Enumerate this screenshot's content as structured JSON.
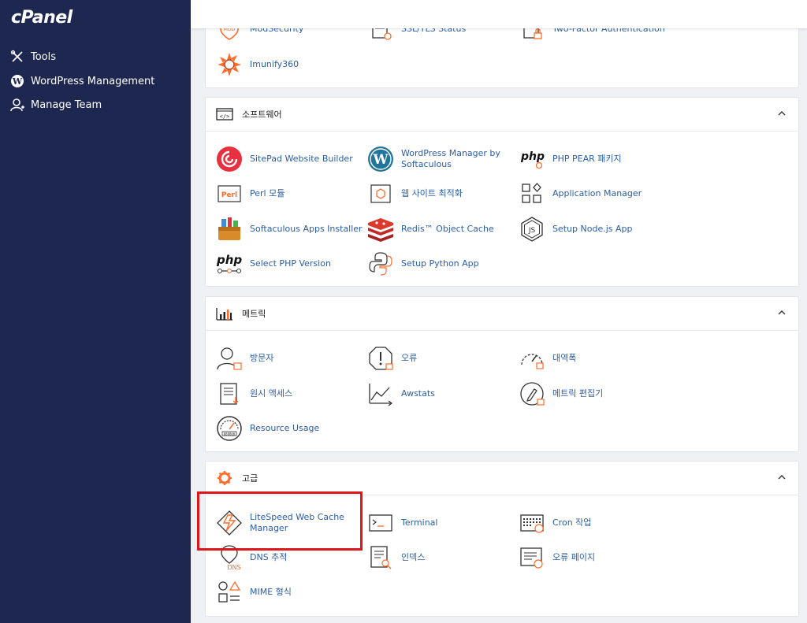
{
  "sidebar": {
    "logo": "cPanel",
    "items": [
      {
        "label": "Tools",
        "icon": "tools-icon"
      },
      {
        "label": "WordPress Management",
        "icon": "wordpress-icon"
      },
      {
        "label": "Manage Team",
        "icon": "manage-team-icon"
      }
    ]
  },
  "security": {
    "items": [
      {
        "label": "ModSecurity",
        "icon": "modsecurity-icon"
      },
      {
        "label": "SSL/TLS Status",
        "icon": "ssl-status-icon"
      },
      {
        "label": "Two-Factor Authentication",
        "icon": "two-factor-icon"
      },
      {
        "label": "Imunify360",
        "icon": "imunify360-icon"
      }
    ]
  },
  "software": {
    "title": "소프트웨어",
    "items": [
      {
        "label": "SitePad Website Builder",
        "icon": "sitepad-icon"
      },
      {
        "label": "WordPress Manager by Softaculous",
        "icon": "wordpress-manager-icon"
      },
      {
        "label": "PHP PEAR 패키지",
        "icon": "php-pear-icon"
      },
      {
        "label": "Perl 모듈",
        "icon": "perl-icon"
      },
      {
        "label": "웹 사이트 최적화",
        "icon": "site-optimize-icon"
      },
      {
        "label": "Application Manager",
        "icon": "application-manager-icon"
      },
      {
        "label": "Softaculous Apps Installer",
        "icon": "softaculous-icon"
      },
      {
        "label": "Redis™ Object Cache",
        "icon": "redis-icon"
      },
      {
        "label": "Setup Node.js App",
        "icon": "nodejs-icon"
      },
      {
        "label": "Select PHP Version",
        "icon": "php-version-icon"
      },
      {
        "label": "Setup Python App",
        "icon": "python-icon"
      }
    ]
  },
  "metrics": {
    "title": "메트릭",
    "items": [
      {
        "label": "방문자",
        "icon": "visitors-icon"
      },
      {
        "label": "오류",
        "icon": "errors-icon"
      },
      {
        "label": "대역폭",
        "icon": "bandwidth-icon"
      },
      {
        "label": "원시 액세스",
        "icon": "raw-access-icon"
      },
      {
        "label": "Awstats",
        "icon": "awstats-icon"
      },
      {
        "label": "메트릭 편집기",
        "icon": "metrics-editor-icon"
      },
      {
        "label": "Resource Usage",
        "icon": "resource-usage-icon"
      }
    ]
  },
  "advanced": {
    "title": "고급",
    "items": [
      {
        "label": "LiteSpeed Web Cache Manager",
        "icon": "litespeed-icon"
      },
      {
        "label": "Terminal",
        "icon": "terminal-icon"
      },
      {
        "label": "Cron 작업",
        "icon": "cron-icon"
      },
      {
        "label": "DNS 추적",
        "icon": "dns-trace-icon"
      },
      {
        "label": "인덱스",
        "icon": "indexes-icon"
      },
      {
        "label": "오류 페이지",
        "icon": "error-pages-icon"
      },
      {
        "label": "MIME 형식",
        "icon": "mime-types-icon"
      }
    ]
  },
  "colors": {
    "sidebar_bg": "#1d2750",
    "link": "#2a5ea8",
    "accent": "#ff6c2c",
    "highlight": "#e0161b"
  }
}
